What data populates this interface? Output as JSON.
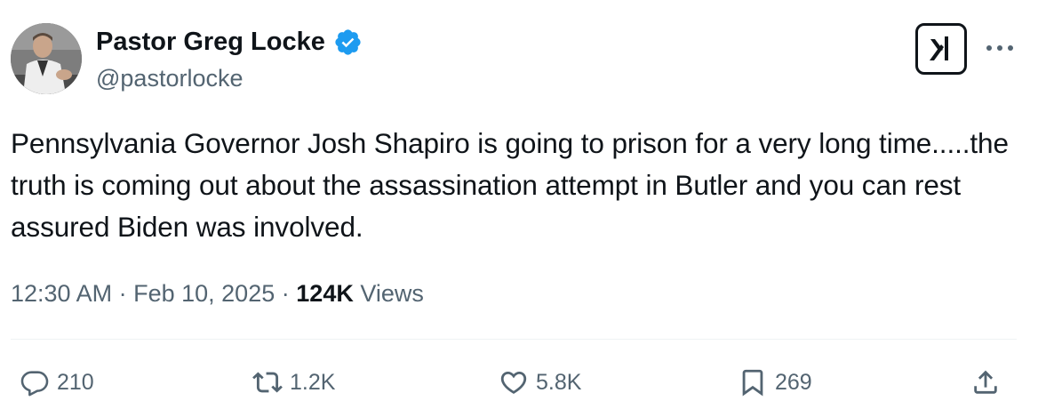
{
  "author": {
    "name": "Pastor Greg Locke",
    "handle": "@pastorlocke",
    "verified": true,
    "verified_color": "#1d9bf0"
  },
  "tweet": {
    "text": "Pennsylvania Governor Josh Shapiro is going to prison for a very long time.....the truth is coming out about the assassination attempt in Butler and you can rest assured Biden was involved.",
    "time": "12:30 AM",
    "separator": "·",
    "date": "Feb 10, 2025",
    "views_count": "124K",
    "views_label": "Views"
  },
  "actions": {
    "replies": "210",
    "reposts": "1.2K",
    "likes": "5.8K",
    "bookmarks": "269"
  },
  "icons": {
    "grok": "grok-icon",
    "more": "more-dots-icon",
    "reply": "reply-icon",
    "repost": "repost-icon",
    "like": "heart-icon",
    "bookmark": "bookmark-icon",
    "share": "share-icon"
  },
  "colors": {
    "text_primary": "#0f1419",
    "text_secondary": "#536471",
    "divider": "#eff3f4"
  }
}
